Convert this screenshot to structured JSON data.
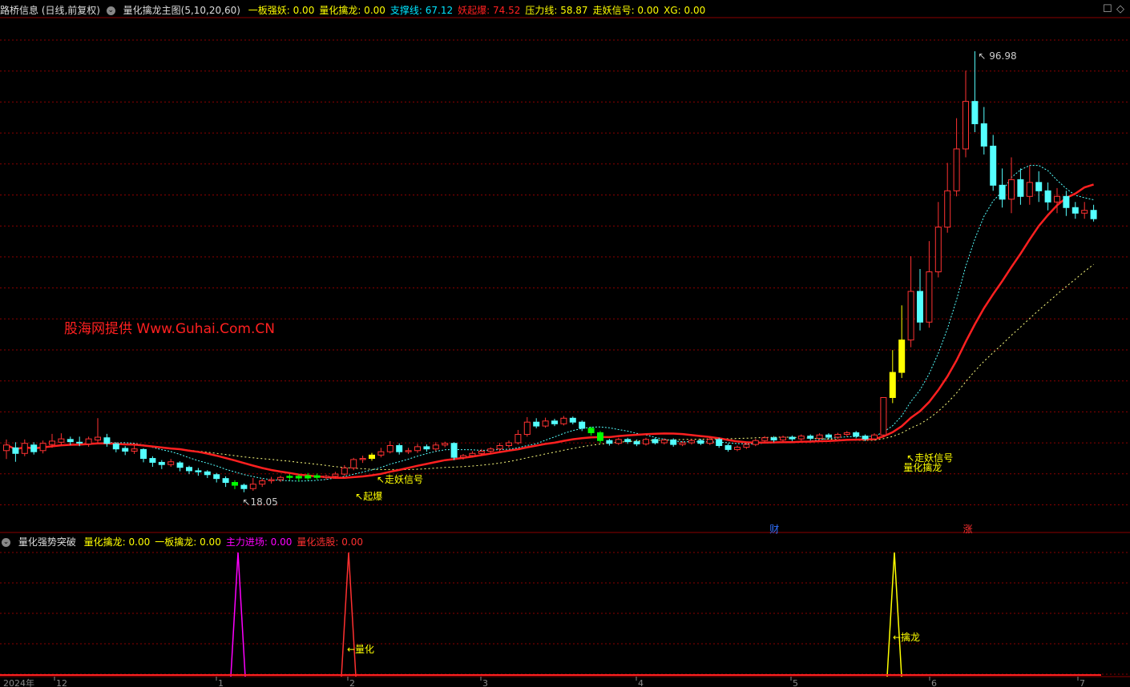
{
  "main_header": {
    "stock": "路桥信息 (日线,前复权)",
    "indicator": "量化擒龙主图(5,10,20,60)",
    "items": [
      {
        "label": "一板强妖:",
        "value": "0.00",
        "color": "#ffff00"
      },
      {
        "label": "量化擒龙:",
        "value": "0.00",
        "color": "#ffff00"
      },
      {
        "label": "支撑线:",
        "value": "67.12",
        "color": "#00e5ff"
      },
      {
        "label": "妖起爆:",
        "value": "74.52",
        "color": "#ff2020"
      },
      {
        "label": "压力线:",
        "value": "58.87",
        "color": "#ffff00"
      },
      {
        "label": "走妖信号:",
        "value": "0.00",
        "color": "#ffff00"
      },
      {
        "label": "XG:",
        "value": "0.00",
        "color": "#ffff00"
      }
    ]
  },
  "sub_header": {
    "indicator": "量化强势突破",
    "items": [
      {
        "label": "量化擒龙:",
        "value": "0.00",
        "color": "#ffff00"
      },
      {
        "label": "一板擒龙:",
        "value": "0.00",
        "color": "#ffff00"
      },
      {
        "label": "主力进场:",
        "value": "0.00",
        "color": "#ff00ff"
      },
      {
        "label": "量化选股:",
        "value": "0.00",
        "color": "#ff3030"
      }
    ]
  },
  "watermark": "股海网提供 Www.Guhai.Com.CN",
  "annotations": {
    "high": "96.98",
    "low": "18.05",
    "zoumao1": "走妖信号",
    "zoumao2": "走妖信号",
    "qibao": "起爆",
    "qinlong_main": "量化擒龙",
    "lianghua_sub": "量化",
    "qinlong_sub": "擒龙",
    "cai": "财",
    "zhang": "涨"
  },
  "x_axis": {
    "year": "2024年",
    "months": [
      "12",
      "1",
      "2",
      "3",
      "4",
      "5",
      "6",
      "7"
    ]
  },
  "colors": {
    "up": "#ff3232",
    "down": "#54ffff",
    "signal_yellow": "#ffff00",
    "signal_green": "#00ff00",
    "magenta": "#ff00ff",
    "grid": "#8b0000"
  },
  "chart_data": {
    "type": "candlestick",
    "y_range": [
      13,
      103
    ],
    "high_marker": 96.98,
    "low_marker": 18.05,
    "candles": [
      [
        25.5,
        26.5,
        24.0,
        27.5
      ],
      [
        26.0,
        25.0,
        23.5,
        27.0
      ],
      [
        25.0,
        26.8,
        24.5,
        27.5
      ],
      [
        26.5,
        25.3,
        24.8,
        27.0
      ],
      [
        25.5,
        26.8,
        25.0,
        27.3
      ],
      [
        26.6,
        27.2,
        26.0,
        28.5
      ],
      [
        27.0,
        27.6,
        26.5,
        28.6
      ],
      [
        27.5,
        27.1,
        26.5,
        28.0
      ],
      [
        27.0,
        26.9,
        26.3,
        28.0
      ],
      [
        26.7,
        27.6,
        26.2,
        28.0
      ],
      [
        27.4,
        27.9,
        26.8,
        31.3
      ],
      [
        27.8,
        26.8,
        26.2,
        28.5
      ],
      [
        26.7,
        25.8,
        25.2,
        27.0
      ],
      [
        25.9,
        25.4,
        24.7,
        26.3
      ],
      [
        25.4,
        25.8,
        24.9,
        26.4
      ],
      [
        25.7,
        24.1,
        23.4,
        25.9
      ],
      [
        24.1,
        23.4,
        22.6,
        24.5
      ],
      [
        23.4,
        23.0,
        22.2,
        23.8
      ],
      [
        23.0,
        23.5,
        22.6,
        24.0
      ],
      [
        23.3,
        22.5,
        21.8,
        23.6
      ],
      [
        22.5,
        21.9,
        21.3,
        22.8
      ],
      [
        21.9,
        21.7,
        21.0,
        22.4
      ],
      [
        21.7,
        21.2,
        20.6,
        22.0
      ],
      [
        21.2,
        20.5,
        19.8,
        21.5
      ],
      [
        20.5,
        19.8,
        19.0,
        20.9
      ],
      [
        19.8,
        19.3,
        18.6,
        20.2
      ],
      [
        19.3,
        18.7,
        18.05,
        19.6
      ],
      [
        18.7,
        19.5,
        18.3,
        20.6
      ],
      [
        19.5,
        20.1,
        19.0,
        20.5
      ],
      [
        20.1,
        20.3,
        19.6,
        20.8
      ],
      [
        20.3,
        20.7,
        19.9,
        21.0
      ],
      [
        20.7,
        20.9,
        20.2,
        21.3
      ],
      [
        20.9,
        20.6,
        20.0,
        21.3
      ],
      [
        20.6,
        21.0,
        20.2,
        21.5
      ],
      [
        21.0,
        20.7,
        20.3,
        21.4
      ],
      [
        20.7,
        20.9,
        20.3,
        21.2
      ],
      [
        20.9,
        21.3,
        20.5,
        21.7
      ],
      [
        21.3,
        22.4,
        21.0,
        22.9
      ],
      [
        22.4,
        23.9,
        22.0,
        24.2
      ],
      [
        23.9,
        24.1,
        23.3,
        24.6
      ],
      [
        24.1,
        24.7,
        23.7,
        25.1
      ],
      [
        24.7,
        25.3,
        24.3,
        26.0
      ],
      [
        25.3,
        26.4,
        25.0,
        27.2
      ],
      [
        26.4,
        25.3,
        24.8,
        26.8
      ],
      [
        25.3,
        25.5,
        24.9,
        26.0
      ],
      [
        25.5,
        26.2,
        25.1,
        26.7
      ],
      [
        26.2,
        25.8,
        25.3,
        26.6
      ],
      [
        25.8,
        26.5,
        25.4,
        27.0
      ],
      [
        26.5,
        26.8,
        26.1,
        27.1
      ],
      [
        26.8,
        24.3,
        23.8,
        27.0
      ],
      [
        24.3,
        24.6,
        23.9,
        24.9
      ],
      [
        24.6,
        25.0,
        24.3,
        25.4
      ],
      [
        25.0,
        25.4,
        24.6,
        25.8
      ],
      [
        25.4,
        25.8,
        24.9,
        26.1
      ],
      [
        25.8,
        26.4,
        25.4,
        26.9
      ],
      [
        26.4,
        26.9,
        26.0,
        27.3
      ],
      [
        26.9,
        28.4,
        26.6,
        29.2
      ],
      [
        28.4,
        30.6,
        28.0,
        31.5
      ],
      [
        30.6,
        29.9,
        29.5,
        31.3
      ],
      [
        29.9,
        30.8,
        29.6,
        31.4
      ],
      [
        30.8,
        30.3,
        29.9,
        31.2
      ],
      [
        30.3,
        31.3,
        30.0,
        31.7
      ],
      [
        31.3,
        30.6,
        30.2,
        31.6
      ],
      [
        30.6,
        29.5,
        29.0,
        30.9
      ],
      [
        29.5,
        28.7,
        28.2,
        29.8
      ],
      [
        28.7,
        27.3,
        26.8,
        29.0
      ],
      [
        27.3,
        26.8,
        26.4,
        27.6
      ],
      [
        26.8,
        27.5,
        26.5,
        27.8
      ],
      [
        27.5,
        27.1,
        26.7,
        27.8
      ],
      [
        27.1,
        26.7,
        26.3,
        27.5
      ],
      [
        26.7,
        27.5,
        26.4,
        27.8
      ],
      [
        27.5,
        26.9,
        26.6,
        27.8
      ],
      [
        26.9,
        27.4,
        26.6,
        27.7
      ],
      [
        27.4,
        26.6,
        26.2,
        27.7
      ],
      [
        26.6,
        26.9,
        26.3,
        27.2
      ],
      [
        26.9,
        27.3,
        26.6,
        27.6
      ],
      [
        27.3,
        26.8,
        26.5,
        27.6
      ],
      [
        26.8,
        27.5,
        26.5,
        27.9
      ],
      [
        27.5,
        26.4,
        26.0,
        27.8
      ],
      [
        26.4,
        25.7,
        25.3,
        26.8
      ],
      [
        25.7,
        26.1,
        25.4,
        26.4
      ],
      [
        26.1,
        26.6,
        25.8,
        26.9
      ],
      [
        26.6,
        27.3,
        26.3,
        27.6
      ],
      [
        27.3,
        27.8,
        27.0,
        28.1
      ],
      [
        27.8,
        27.4,
        27.0,
        28.1
      ],
      [
        27.4,
        27.9,
        27.1,
        28.2
      ],
      [
        27.9,
        27.6,
        27.2,
        28.2
      ],
      [
        27.6,
        28.1,
        27.3,
        28.4
      ],
      [
        28.1,
        27.7,
        27.3,
        28.4
      ],
      [
        27.7,
        28.3,
        27.4,
        28.6
      ],
      [
        28.3,
        27.9,
        27.5,
        28.6
      ],
      [
        27.9,
        28.4,
        27.6,
        28.7
      ],
      [
        28.4,
        28.7,
        28.0,
        29.0
      ],
      [
        28.7,
        28.1,
        27.7,
        29.0
      ],
      [
        28.1,
        27.6,
        27.2,
        28.4
      ],
      [
        27.6,
        28.3,
        27.3,
        28.6
      ],
      [
        28.3,
        35.0,
        28.0,
        35.0
      ],
      [
        35.0,
        39.5,
        34.0,
        43.5
      ],
      [
        39.5,
        45.3,
        38.5,
        51.5
      ],
      [
        45.3,
        54.0,
        44.0,
        60.3
      ],
      [
        54.0,
        48.5,
        47.0,
        58.0
      ],
      [
        48.5,
        57.5,
        47.5,
        63.0
      ],
      [
        57.5,
        65.5,
        56.5,
        70.0
      ],
      [
        65.5,
        72.0,
        64.5,
        77.0
      ],
      [
        72.0,
        79.5,
        71.0,
        85.0
      ],
      [
        79.5,
        88.0,
        78.0,
        93.5
      ],
      [
        88.0,
        84.0,
        82.5,
        96.98
      ],
      [
        84.0,
        80.0,
        78.5,
        87.0
      ],
      [
        80.0,
        73.0,
        72.0,
        82.0
      ],
      [
        73.0,
        70.5,
        69.0,
        76.0
      ],
      [
        70.5,
        74.0,
        68.0,
        78.0
      ],
      [
        74.0,
        71.0,
        69.5,
        76.0
      ],
      [
        71.0,
        73.5,
        69.5,
        76.5
      ],
      [
        73.5,
        72.0,
        70.0,
        75.5
      ],
      [
        72.0,
        70.0,
        68.5,
        73.5
      ],
      [
        70.0,
        71.0,
        68.0,
        72.5
      ],
      [
        71.0,
        69.0,
        67.5,
        72.0
      ],
      [
        69.0,
        68.0,
        67.0,
        70.0
      ],
      [
        68.0,
        68.5,
        67.0,
        70.0
      ],
      [
        68.5,
        67.0,
        66.5,
        69.5
      ]
    ]
  }
}
